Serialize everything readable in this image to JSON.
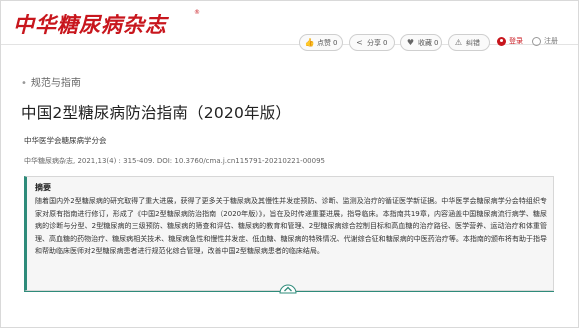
{
  "header": {
    "logo_text": "中华糖尿病杂志",
    "logo_mark": "®",
    "actions": {
      "like": {
        "label": "点赞",
        "count": "0",
        "icon": "thumbs-up-icon"
      },
      "share": {
        "label": "分享",
        "count": "0",
        "icon": "share-icon"
      },
      "favorite": {
        "label": "收藏",
        "count": "0",
        "icon": "heart-icon"
      },
      "error": {
        "label": "纠错",
        "icon": "warning-icon"
      }
    },
    "login_label": "登录",
    "register_label": "注册"
  },
  "breadcrumb": {
    "label": "规范与指南"
  },
  "article": {
    "title": "中国2型糖尿病防治指南（2020年版）",
    "author": "中华医学会糖尿病学分会",
    "citation": "中华糖尿病杂志, 2021,13(4) : 315-409. DOI: 10.3760/cma.j.cn115791-20210221-00095",
    "abstract_heading": "摘要",
    "abstract": "随着国内外2型糖尿病的研究取得了重大进展，获得了更多关于糖尿病及其慢性并发症预防、诊断、监测及治疗的循证医学新证据。中华医学会糖尿病学分会特组织专家对原有指南进行修订，形成了《中国2型糖尿病防治指南（2020年版）》，旨在及时传递重要进展，指导临床。本指南共19章，内容涵盖中国糖尿病流行病学、糖尿病的诊断与分型、2型糖尿病的三级预防、糖尿病的筛查和评估、糖尿病的教育和管理、2型糖尿病综合控制目标和高血糖的治疗路径、医学营养、运动治疗和体重管理、高血糖的药物治疗、糖尿病相关技术、糖尿病急性和慢性并发症、低血糖、糖尿病的特殊情况、代谢综合征和糖尿病的中医药治疗等。本指南的颁布将有助于指导和帮助临床医师对2型糖尿病患者进行规范化综合管理，改善中国2型糖尿病患者的临床结局。"
  },
  "colors": {
    "brand_red": "#c8161d",
    "accent_teal": "#2e8b7a"
  }
}
